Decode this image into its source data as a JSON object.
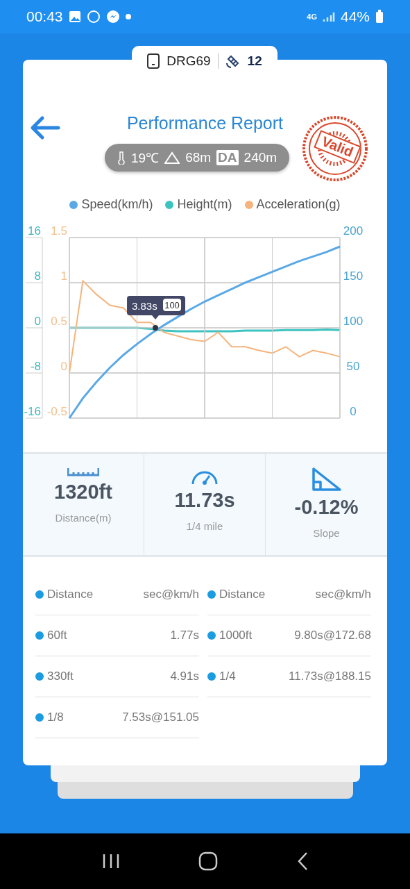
{
  "status_bar": {
    "time": "00:43",
    "network": "4G",
    "battery": "44%"
  },
  "device": {
    "name": "DRG69",
    "satellites": "12"
  },
  "header": {
    "title": "Performance Report",
    "stamp": "Valid"
  },
  "conditions": {
    "temperature": "19℃",
    "altitude": "68m",
    "da_label": "DA",
    "density_altitude": "240m"
  },
  "chart": {
    "tooltip": {
      "time": "3.83s",
      "value": "100"
    },
    "layers": [
      {
        "kind": "speed",
        "chart_data": {
          "type": "line",
          "grid": true,
          "ylim": [
            0,
            200
          ],
          "yticks": [
            0,
            50,
            100,
            150,
            200
          ],
          "series": [
            {
              "name": "Speed(km/h)",
              "color": "#5aa9e6",
              "values": [
                0,
                22,
                40,
                56,
                70,
                82,
                93,
                103,
                112,
                121,
                129,
                136,
                143,
                150,
                156,
                162,
                168,
                174,
                179,
                184,
                190
              ]
            }
          ]
        }
      },
      {
        "kind": "height",
        "chart_data": {
          "type": "line",
          "grid": true,
          "ylim": [
            -16,
            16
          ],
          "yticks": [
            -16,
            -8,
            0,
            8,
            16
          ],
          "series": [
            {
              "name": "Height(m)",
              "color": "#3cc3c0",
              "values": [
                0,
                0,
                0,
                0,
                0,
                0,
                -0.2,
                -0.5,
                -0.6,
                -0.6,
                -0.6,
                -0.6,
                -0.6,
                -0.5,
                -0.5,
                -0.5,
                -0.4,
                -0.4,
                -0.4,
                -0.3,
                -0.4
              ]
            }
          ]
        }
      },
      {
        "kind": "acceleration",
        "chart_data": {
          "type": "line",
          "grid": true,
          "ylim": [
            -0.5,
            1.5
          ],
          "yticks": [
            -0.5,
            0,
            0.5,
            1,
            1.5
          ],
          "series": [
            {
              "name": "Acceleration(g)",
              "color": "#f5b47c",
              "values": [
                0,
                1.02,
                0.87,
                0.75,
                0.72,
                0.56,
                0.56,
                0.45,
                0.41,
                0.37,
                0.35,
                0.45,
                0.29,
                0.29,
                0.25,
                0.22,
                0.29,
                0.18,
                0.25,
                0.22,
                0.18
              ]
            }
          ]
        }
      }
    ]
  },
  "stats": [
    {
      "kind": "ruler",
      "value": "1320ft",
      "label": "Distance(m)"
    },
    {
      "kind": "gauge",
      "value": "11.73s",
      "label": "1/4 mile"
    },
    {
      "kind": "slope",
      "value": "-0.12%",
      "label": "Slope"
    }
  ],
  "splits": [
    {
      "kind": "header",
      "label": "Distance",
      "value": "sec@km/h"
    },
    {
      "kind": "header",
      "label": "Distance",
      "value": "sec@km/h"
    },
    {
      "kind": "row",
      "label": "60ft",
      "value": "1.77s"
    },
    {
      "kind": "row",
      "label": "1000ft",
      "value": "9.80s@172.68"
    },
    {
      "kind": "row",
      "label": "330ft",
      "value": "4.91s"
    },
    {
      "kind": "row",
      "label": "1/4",
      "value": "11.73s@188.15"
    },
    {
      "kind": "row",
      "label": "1/8",
      "value": "7.53s@151.05"
    }
  ]
}
